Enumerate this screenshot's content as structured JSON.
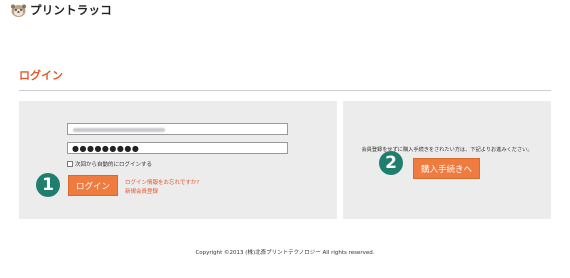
{
  "header": {
    "logo_text": "プリントラッコ"
  },
  "page": {
    "title": "ログイン"
  },
  "login": {
    "password_masked": "●●●●●●●●●",
    "remember_label": "次回から自動的にログインする",
    "login_button": "ログイン",
    "forgot_link": "ログイン情報をお忘れですか?",
    "register_link": "新規会員登録"
  },
  "guest": {
    "text": "会員登録をせずに購入手続きをされたい方は、下記よりお進みください。",
    "purchase_button": "購入手続きへ"
  },
  "markers": {
    "one": "1",
    "two": "2"
  },
  "footer": {
    "copyright": "Copyright ©2013 (株)北斎プリントテクノロジー All rights reserved."
  },
  "colors": {
    "accent": "#e5572c",
    "button": "#ef7b3e",
    "marker": "#1f7e6e",
    "panel": "#ececec"
  }
}
